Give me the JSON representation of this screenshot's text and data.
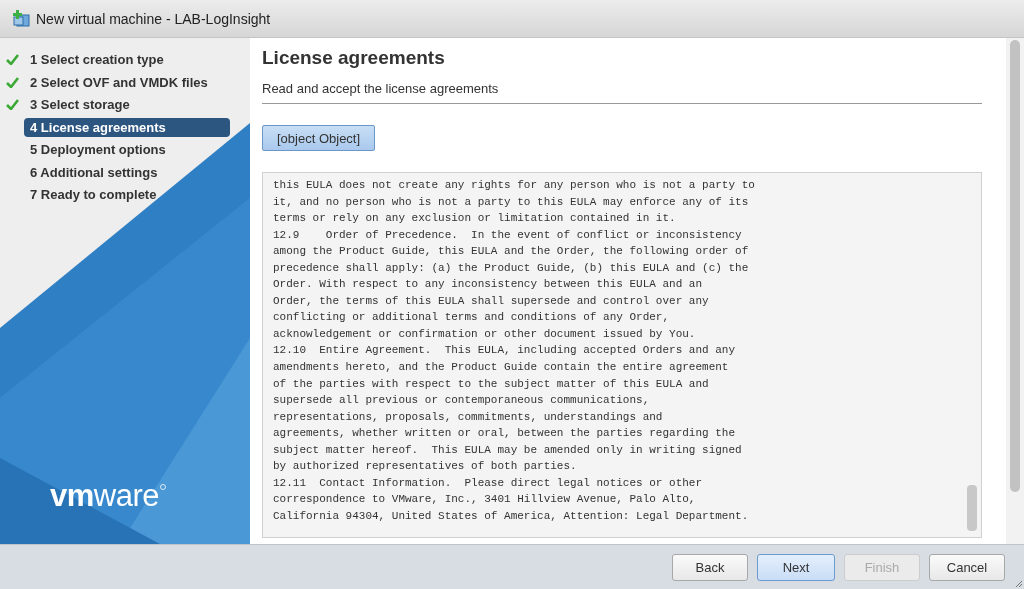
{
  "window": {
    "title": "New virtual machine - LAB-LogInsight"
  },
  "sidebar": {
    "steps": [
      {
        "label": "1 Select creation type",
        "done": true,
        "selected": false
      },
      {
        "label": "2 Select OVF and VMDK files",
        "done": true,
        "selected": false
      },
      {
        "label": "3 Select storage",
        "done": true,
        "selected": false
      },
      {
        "label": "4 License agreements",
        "done": false,
        "selected": true
      },
      {
        "label": "5 Deployment options",
        "done": false,
        "selected": false
      },
      {
        "label": "6 Additional settings",
        "done": false,
        "selected": false
      },
      {
        "label": "7 Ready to complete",
        "done": false,
        "selected": false
      }
    ],
    "logo": "**vm**ware"
  },
  "content": {
    "title": "License agreements",
    "subtitle": "Read and accept the license agreements",
    "agreement_button": "[object Object]",
    "license_text": "this EULA does not create any rights for any person who is not a party to\nit, and no person who is not a party to this EULA may enforce any of its\nterms or rely on any exclusion or limitation contained in it.\n12.9    Order of Precedence.  In the event of conflict or inconsistency\namong the Product Guide, this EULA and the Order, the following order of\nprecedence shall apply: (a) the Product Guide, (b) this EULA and (c) the\nOrder. With respect to any inconsistency between this EULA and an\nOrder, the terms of this EULA shall supersede and control over any\nconflicting or additional terms and conditions of any Order,\nacknowledgement or confirmation or other document issued by You.\n12.10  Entire Agreement.  This EULA, including accepted Orders and any\namendments hereto, and the Product Guide contain the entire agreement\nof the parties with respect to the subject matter of this EULA and\nsupersede all previous or contemporaneous communications,\nrepresentations, proposals, commitments, understandings and\nagreements, whether written or oral, between the parties regarding the\nsubject matter hereof.  This EULA may be amended only in writing signed\nby authorized representatives of both parties.\n12.11  Contact Information.  Please direct legal notices or other\ncorrespondence to VMware, Inc., 3401 Hillview Avenue, Palo Alto,\nCalifornia 94304, United States of America, Attention: Legal Department."
  },
  "buttons": [
    {
      "label": "Back",
      "primary": false,
      "disabled": false
    },
    {
      "label": "Next",
      "primary": true,
      "disabled": false
    },
    {
      "label": "Finish",
      "primary": false,
      "disabled": true
    },
    {
      "label": "Cancel",
      "primary": false,
      "disabled": false
    }
  ]
}
